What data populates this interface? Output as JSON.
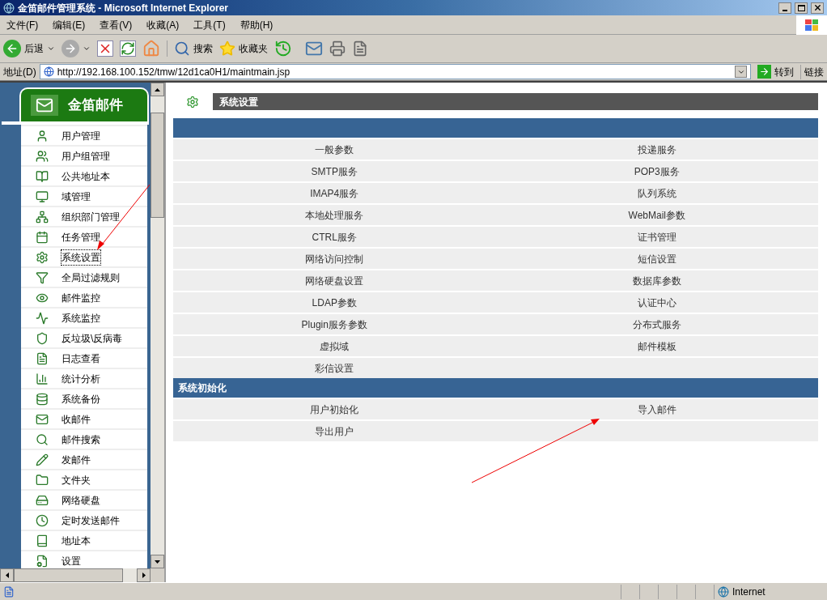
{
  "window": {
    "title": "金笛邮件管理系统 - Microsoft Internet Explorer"
  },
  "menu": [
    "文件(F)",
    "编辑(E)",
    "查看(V)",
    "收藏(A)",
    "工具(T)",
    "帮助(H)"
  ],
  "toolbar": {
    "back": "后退",
    "search": "搜索",
    "favorites": "收藏夹"
  },
  "address": {
    "label": "地址(D)",
    "value": "http://192.168.100.152/tmw/12d1ca0H1/maintmain.jsp",
    "go": "转到",
    "links": "链接"
  },
  "sidebar": {
    "title": "金笛邮件",
    "items": [
      {
        "label": "用户管理",
        "selected": false
      },
      {
        "label": "用户组管理",
        "selected": false
      },
      {
        "label": "公共地址本",
        "selected": false
      },
      {
        "label": "域管理",
        "selected": false
      },
      {
        "label": "组织部门管理",
        "selected": false
      },
      {
        "label": "任务管理",
        "selected": false
      },
      {
        "label": "系统设置",
        "selected": true
      },
      {
        "label": "全局过滤规则",
        "selected": false
      },
      {
        "label": "邮件监控",
        "selected": false
      },
      {
        "label": "系统监控",
        "selected": false
      },
      {
        "label": "反垃圾\\反病毒",
        "selected": false
      },
      {
        "label": "日志查看",
        "selected": false
      },
      {
        "label": "统计分析",
        "selected": false
      },
      {
        "label": "系统备份",
        "selected": false
      },
      {
        "label": "收邮件",
        "selected": false
      },
      {
        "label": "邮件搜索",
        "selected": false
      },
      {
        "label": "发邮件",
        "selected": false
      },
      {
        "label": "文件夹",
        "selected": false
      },
      {
        "label": "网络硬盘",
        "selected": false
      },
      {
        "label": "定时发送邮件",
        "selected": false
      },
      {
        "label": "地址本",
        "selected": false
      },
      {
        "label": "设置",
        "selected": false
      }
    ]
  },
  "main": {
    "title": "系统设置",
    "sections": [
      {
        "items": [
          "一般参数",
          "投递服务",
          "SMTP服务",
          "POP3服务",
          "IMAP4服务",
          "队列系统",
          "本地处理服务",
          "WebMail参数",
          "CTRL服务",
          "证书管理",
          "网络访问控制",
          "短信设置",
          "网络硬盘设置",
          "数据库参数",
          "LDAP参数",
          "认证中心",
          "Plugin服务参数",
          "分布式服务",
          "虚拟域",
          "邮件模板",
          "彩信设置"
        ]
      },
      {
        "title": "系统初始化",
        "items": [
          "用户初始化",
          "导入邮件",
          "导出用户"
        ]
      }
    ]
  },
  "status_bar": {
    "zone": "Internet"
  }
}
